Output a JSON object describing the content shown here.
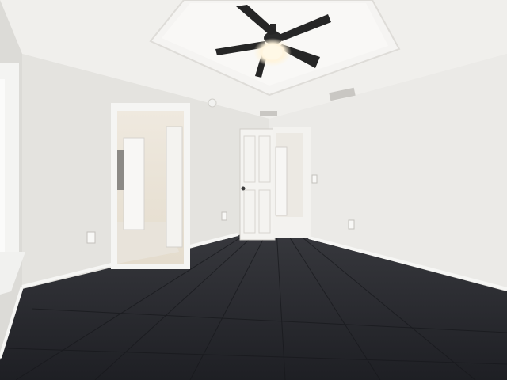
{
  "scene": {
    "colors": {
      "ceiling": "#f1f0ee",
      "ceiling_tray": "#f6f5f3",
      "wall_left": "#e6e5e1",
      "wall_center": "#e3e2de",
      "wall_right": "#ebeae7",
      "floor": "#2a2b30",
      "floor_plank": "#1f2025",
      "baseboard": "#f7f7f5",
      "door": "#f3f2ef",
      "fan_blade": "#262626",
      "fan_light": "#fff4dc"
    },
    "icons": [
      "ceiling-fan-icon",
      "air-vent-icon",
      "smoke-detector-icon",
      "light-switch-icon",
      "power-outlet-icon"
    ]
  }
}
